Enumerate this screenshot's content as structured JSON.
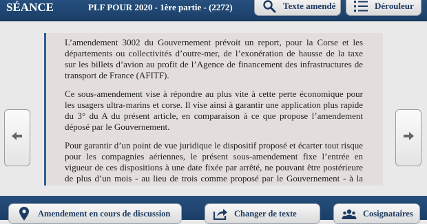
{
  "header": {
    "seance": "SÉANCE",
    "title": "PLF POUR 2020 - 1ère partie - (2272)",
    "texte_amende_label": "Texte amendé",
    "derouleur_label": "Dérouleur"
  },
  "content": {
    "paragraphs": [
      "L’amendement 3002 du Gouvernement prévoit un report, pour la Corse et les départements ou collectivités d’outre-mer, de l’exonération de hausse de la taxe sur les billets d’avion au profit de l’Agence de financement des infrastructures de transport de France (AFITF).",
      "Ce sous-amendement vise à répondre au plus vite à cette perte économique pour les usagers ultra-marins et corse. Il vise ainsi à garantir une application plus rapide du 3° du A du présent article, en comparaison à ce que propose l’amendement déposé par le Gouvernement.",
      "Pour garantir d’un point de vue juridique le dispositif proposé et écarter tout risque pour les compagnies aériennes, le présent sous-amendement fixe l’entrée en vigueur de ces dispositions à une date fixée par arrêté, ne pouvant être postérieure de plus d’un mois - au lieu de trois comme proposé par le Gouvernement - à la réponse de la Commission européenne permettant de considérer ce dispositif"
    ]
  },
  "footer": {
    "amendement_label": "Amendement en cours de discussion",
    "changer_label": "Changer de texte",
    "cosignataires_label": "Cosignataires"
  },
  "icons": {
    "search": "search-icon",
    "list": "list-icon",
    "arrow_left": "arrow-left-icon",
    "arrow_right": "arrow-right-icon",
    "location_pin": "location-pin-icon",
    "share": "share-icon",
    "group": "group-icon"
  },
  "colors": {
    "header_bg": "#1f4570",
    "button_text": "#1d3a62",
    "content_bg": "#e3dedd",
    "content_border": "#305e95"
  }
}
